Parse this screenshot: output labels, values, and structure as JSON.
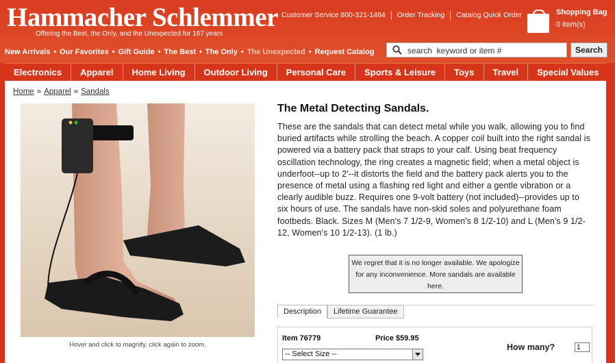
{
  "brand": {
    "name": "Hammacher Schlemmer",
    "tagline": "Offering the Best, the Only, and the Unexpected for 167 years"
  },
  "utility_links": [
    {
      "label": "Customer Service"
    },
    {
      "label": "800-321-1484"
    },
    {
      "label": "Order Tracking"
    },
    {
      "label": "Catalog Quick Order"
    }
  ],
  "shopping_bag": {
    "title": "Shopping Bag",
    "count": "0 item(s)",
    "icon": "shopping-bag-icon"
  },
  "sub_nav": [
    {
      "label": "New Arrivals"
    },
    {
      "label": "Our Favorites"
    },
    {
      "label": "Gift Guide"
    },
    {
      "label": "The Best"
    },
    {
      "label": "The Only"
    },
    {
      "label": "The Unexpected"
    },
    {
      "label": "Request Catalog"
    }
  ],
  "search": {
    "placeholder": "search  keyword or item #",
    "button": "Search",
    "icon": "search-icon"
  },
  "categories": [
    {
      "label": "Electronics"
    },
    {
      "label": "Apparel"
    },
    {
      "label": "Home Living"
    },
    {
      "label": "Outdoor Living"
    },
    {
      "label": "Personal Care"
    },
    {
      "label": "Sports & Leisure"
    },
    {
      "label": "Toys"
    },
    {
      "label": "Travel"
    },
    {
      "label": "Special Values"
    }
  ],
  "breadcrumb": {
    "home": "Home",
    "sep1": "»",
    "apparel": "Apparel",
    "sep2": "»",
    "sandals": "Sandals"
  },
  "product": {
    "title": "The Metal Detecting Sandals.",
    "description": "These are the sandals that can detect metal while you walk, allowing you to find buried artifacts while strolling the beach. A copper coil built into the right sandal is powered via a battery pack that straps to your calf. Using beat frequency oscillation technology, the ring creates a magnetic field; when a metal object is underfoot--up to 2'--it distorts the field and the battery pack alerts you to the presence of metal using a flashing red light and either a gentle vibration or a clearly audible buzz. Requires one 9-volt battery (not included)--provides up to six hours of use. The sandals have non-skid soles and polyurethane foam footbeds. Black. Sizes M (Men's 7 1/2-9, Women's 8 1/2-10) and L (Men's 9 1/2-12, Women's 10 1/2-13). (1 lb.)",
    "image_caption": "Hover and click to magnify, click again to zoom.",
    "notice": "We regret that it is no longer available. We apologize for any inconvenience. More sandals are available here.",
    "tabs": [
      {
        "label": "Description",
        "active": true
      },
      {
        "label": "Lifetime Guarantee",
        "active": false
      }
    ],
    "item_number": "Item 76779",
    "price": "Price $59.95",
    "quantity_label": "How many?",
    "quantity_value": "1",
    "size_select": "-- Select Size --"
  },
  "colors": {
    "header_red": "#d93b1f",
    "nav_red": "#d7351a",
    "white": "#ffffff"
  }
}
